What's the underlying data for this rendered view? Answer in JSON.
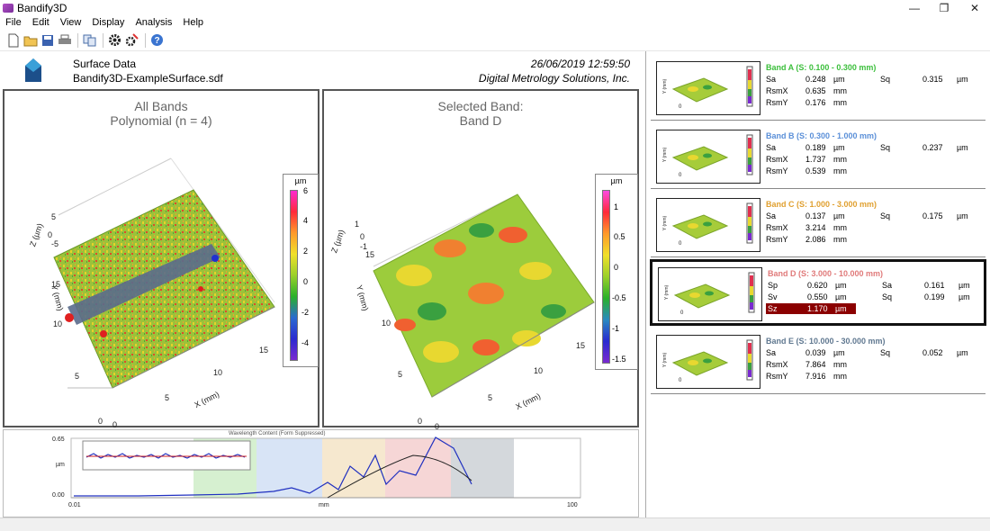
{
  "window": {
    "title": "Bandify3D",
    "minimize": "—",
    "restore": "❐",
    "close": "✕"
  },
  "menu": [
    "File",
    "Edit",
    "View",
    "Display",
    "Analysis",
    "Help"
  ],
  "header": {
    "label": "Surface Data",
    "file": "Bandify3D-ExampleSurface.sdf",
    "datetime": "26/06/2019  12:59:50",
    "company": "Digital Metrology Solutions, Inc."
  },
  "plot_left": {
    "title_line1": "All Bands",
    "title_line2": "Polynomial (n = 4)",
    "colorbar_unit": "µm",
    "colorbar_ticks": [
      "6",
      "4",
      "2",
      "0",
      "-2",
      "-4"
    ],
    "z_label": "Z (µm)",
    "y_label": "Y (mm)",
    "x_label": "X (mm)",
    "z_ticks": [
      "5",
      "0",
      "-5"
    ],
    "y_ticks": [
      "15",
      "10",
      "5",
      "0"
    ],
    "x_ticks": [
      "0",
      "5",
      "10",
      "15"
    ]
  },
  "plot_right": {
    "title_line1": "Selected Band:",
    "title_line2": "Band D",
    "colorbar_unit": "µm",
    "colorbar_ticks": [
      "1",
      "0.5",
      "0",
      "-0.5",
      "-1",
      "-1.5"
    ],
    "z_label": "Z (µm)",
    "y_label": "Y (mm)",
    "x_label": "X (mm)",
    "z_ticks": [
      "1",
      "0",
      "-1"
    ],
    "y_ticks": [
      "15",
      "10",
      "5",
      "0"
    ],
    "x_ticks": [
      "0",
      "5",
      "10",
      "15"
    ]
  },
  "spectrum": {
    "title": "Wavelength Content (Form Suppressed)",
    "y_top": "0.65",
    "y_unit": "µm",
    "y_bottom": "0.00",
    "x_left": "0.01",
    "x_unit": "mm",
    "x_right": "100"
  },
  "bands": [
    {
      "name": "Band A  (S: 0.100 - 0.300 mm)",
      "color": "#3cbf3c",
      "stats": [
        [
          "Sa",
          "0.248",
          "µm"
        ],
        [
          "RsmX",
          "0.635",
          "mm"
        ],
        [
          "RsmY",
          "0.176",
          "mm"
        ]
      ],
      "right": [
        [
          "Sq",
          "0.315",
          "µm"
        ]
      ]
    },
    {
      "name": "Band B  (S: 0.300 - 1.000 mm)",
      "color": "#5a8fd8",
      "stats": [
        [
          "Sa",
          "0.189",
          "µm"
        ],
        [
          "RsmX",
          "1.737",
          "mm"
        ],
        [
          "RsmY",
          "0.539",
          "mm"
        ]
      ],
      "right": [
        [
          "Sq",
          "0.237",
          "µm"
        ]
      ]
    },
    {
      "name": "Band C  (S: 1.000 - 3.000 mm)",
      "color": "#e0a030",
      "stats": [
        [
          "Sa",
          "0.137",
          "µm"
        ],
        [
          "RsmX",
          "3.214",
          "mm"
        ],
        [
          "RsmY",
          "2.086",
          "mm"
        ]
      ],
      "right": [
        [
          "Sq",
          "0.175",
          "µm"
        ]
      ]
    },
    {
      "name": "Band D  (S: 3.000 - 10.000 mm)",
      "color": "#e07a7a",
      "stats": [
        [
          "Sp",
          "0.620",
          "µm"
        ],
        [
          "Sv",
          "0.550",
          "µm"
        ],
        [
          "Sz",
          "1.170",
          "µm"
        ]
      ],
      "right": [
        [
          "Sa",
          "0.161",
          "µm"
        ],
        [
          "Sq",
          "0.199",
          "µm"
        ]
      ]
    },
    {
      "name": "Band E  (S: 10.000 - 30.000 mm)",
      "color": "#607890",
      "stats": [
        [
          "Sa",
          "0.039",
          "µm"
        ],
        [
          "RsmX",
          "7.864",
          "mm"
        ],
        [
          "RsmY",
          "7.916",
          "mm"
        ]
      ],
      "right": [
        [
          "Sq",
          "0.052",
          "µm"
        ]
      ]
    }
  ],
  "thumb_axis": {
    "y": "Y (mm)",
    "zero": "0"
  }
}
